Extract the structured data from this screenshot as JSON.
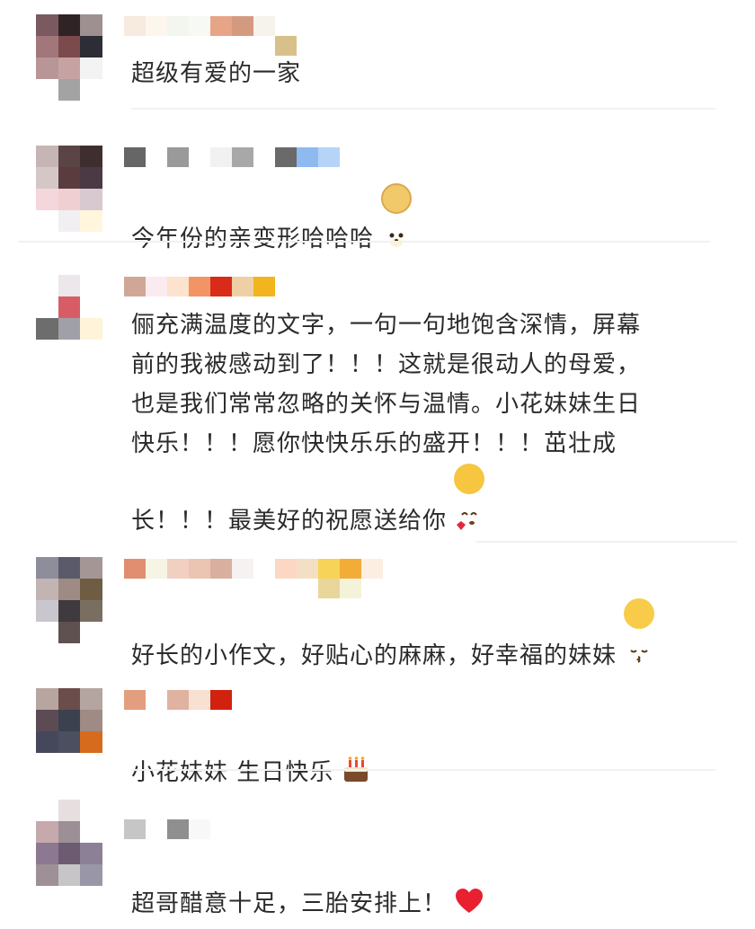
{
  "comments": [
    {
      "text": "超级有爱的一家",
      "emoji": ""
    },
    {
      "text": "今年份的亲变形哈哈哈",
      "emoji": "doge-emoji"
    },
    {
      "text": "俪充满温度的文字，一句一句地饱含深情，屏幕\n前的我被感动到了！！！这就是很动人的母爱，\n也是我们常常忽略的关怀与温情。小花妹妹生日\n快乐！！！愿你快快乐乐的盛开！！！茁壮成\n长！！！最美好的祝愿送给你",
      "emoji": "heart-kiss-emoji"
    },
    {
      "text": "好长的小作文，好贴心的麻麻，好幸福的妹妹",
      "emoji": "kiss-face-emoji"
    },
    {
      "text": "小花妹妹 生日快乐",
      "emoji": "cake-emoji"
    },
    {
      "text": "超哥醋意十足，三胎安排上！",
      "emoji": "red-heart-emoji"
    }
  ],
  "colors": {
    "avatars": [
      [
        "#7a5a60",
        "#2f2326",
        "#9e8f90",
        "#a1777c",
        "#7b4a4d",
        "#8c8c8c",
        "#b89596",
        "#c7a2a3",
        "#f3f3f3",
        "#ffffff",
        "#a3a3a3",
        "#ffffff"
      ],
      [
        "#c7b5b6",
        "#5a4446",
        "#3e2e30",
        "#d6c7c7",
        "#5a3c3f",
        "#4b3a44",
        "#f3d7dc",
        "#f0cfd3",
        "#d7c9cf",
        "#ffffff",
        "#f1eff2",
        "#fff6dd"
      ],
      [
        "#ffffff",
        "#ece7ea",
        "#ffffff",
        "#ffffff",
        "#d85c66",
        "#ffffff",
        "#6d6d6d",
        "#a0a0a8",
        "#fff3d9"
      ],
      [
        "#8d8e99",
        "#5b5a6b",
        "#a59696",
        "#c2b4b3",
        "#9d8b84",
        "#6e5d43",
        "#c9c6ce",
        "#3f3a3d",
        "#7a6e60",
        "#ffffff",
        "#5e514f",
        "#ffffff"
      ],
      [
        "#b7a5a0",
        "#6b4d4b",
        "#b4a5a0",
        "#5c4b54",
        "#3c4150",
        "#9f8a84",
        "#45485a",
        "#4b4f60",
        "#d66b1d"
      ],
      [
        "#ffffff",
        "#e6dedf",
        "#ffffff",
        "#c6a9ad",
        "#9c8f96",
        "#ffffff",
        "#8c7891",
        "#6d5b72",
        "#8c8096",
        "#9d9197",
        "#c8c5c8",
        "#9997a7"
      ]
    ],
    "names": [
      [
        "#f7eadf",
        "#fdf6ec",
        "#f3f6ef",
        "#f7f9f5",
        "#e7a487",
        "#d49a80",
        "#f6f3ec",
        "#ffffff",
        "#d8c08a"
      ],
      [
        "#666666",
        "#ffffff",
        "#9a9a9a",
        "#ffffff",
        "#f1f1f1",
        "#a8a8a8",
        "#ffffff",
        "#6a6a6a",
        "#8fbaf0",
        "#b6d4f8"
      ],
      [
        "#d0a796",
        "#fbeaf0",
        "#fde2cd",
        "#f39465",
        "#d92b1a",
        "#efd0a5",
        "#f2b51f"
      ],
      [
        "#e08e6f",
        "#f6f4e4",
        "#f1d0c2",
        "#ecc4b2",
        "#d9b0a0",
        "#f5f2f1",
        "#ffffff",
        "#fbd7c4",
        "#f3e0c4",
        "#f7d457",
        "#f2ad38",
        "#fcefe2"
      ],
      [
        "#e29e7e",
        "#ffffff",
        "#e0b2a0",
        "#f8e0d3",
        "#d0220e"
      ],
      [
        "#c6c6c6",
        "#ffffff",
        "#8f8f8f",
        "#f8f8f8"
      ]
    ]
  }
}
